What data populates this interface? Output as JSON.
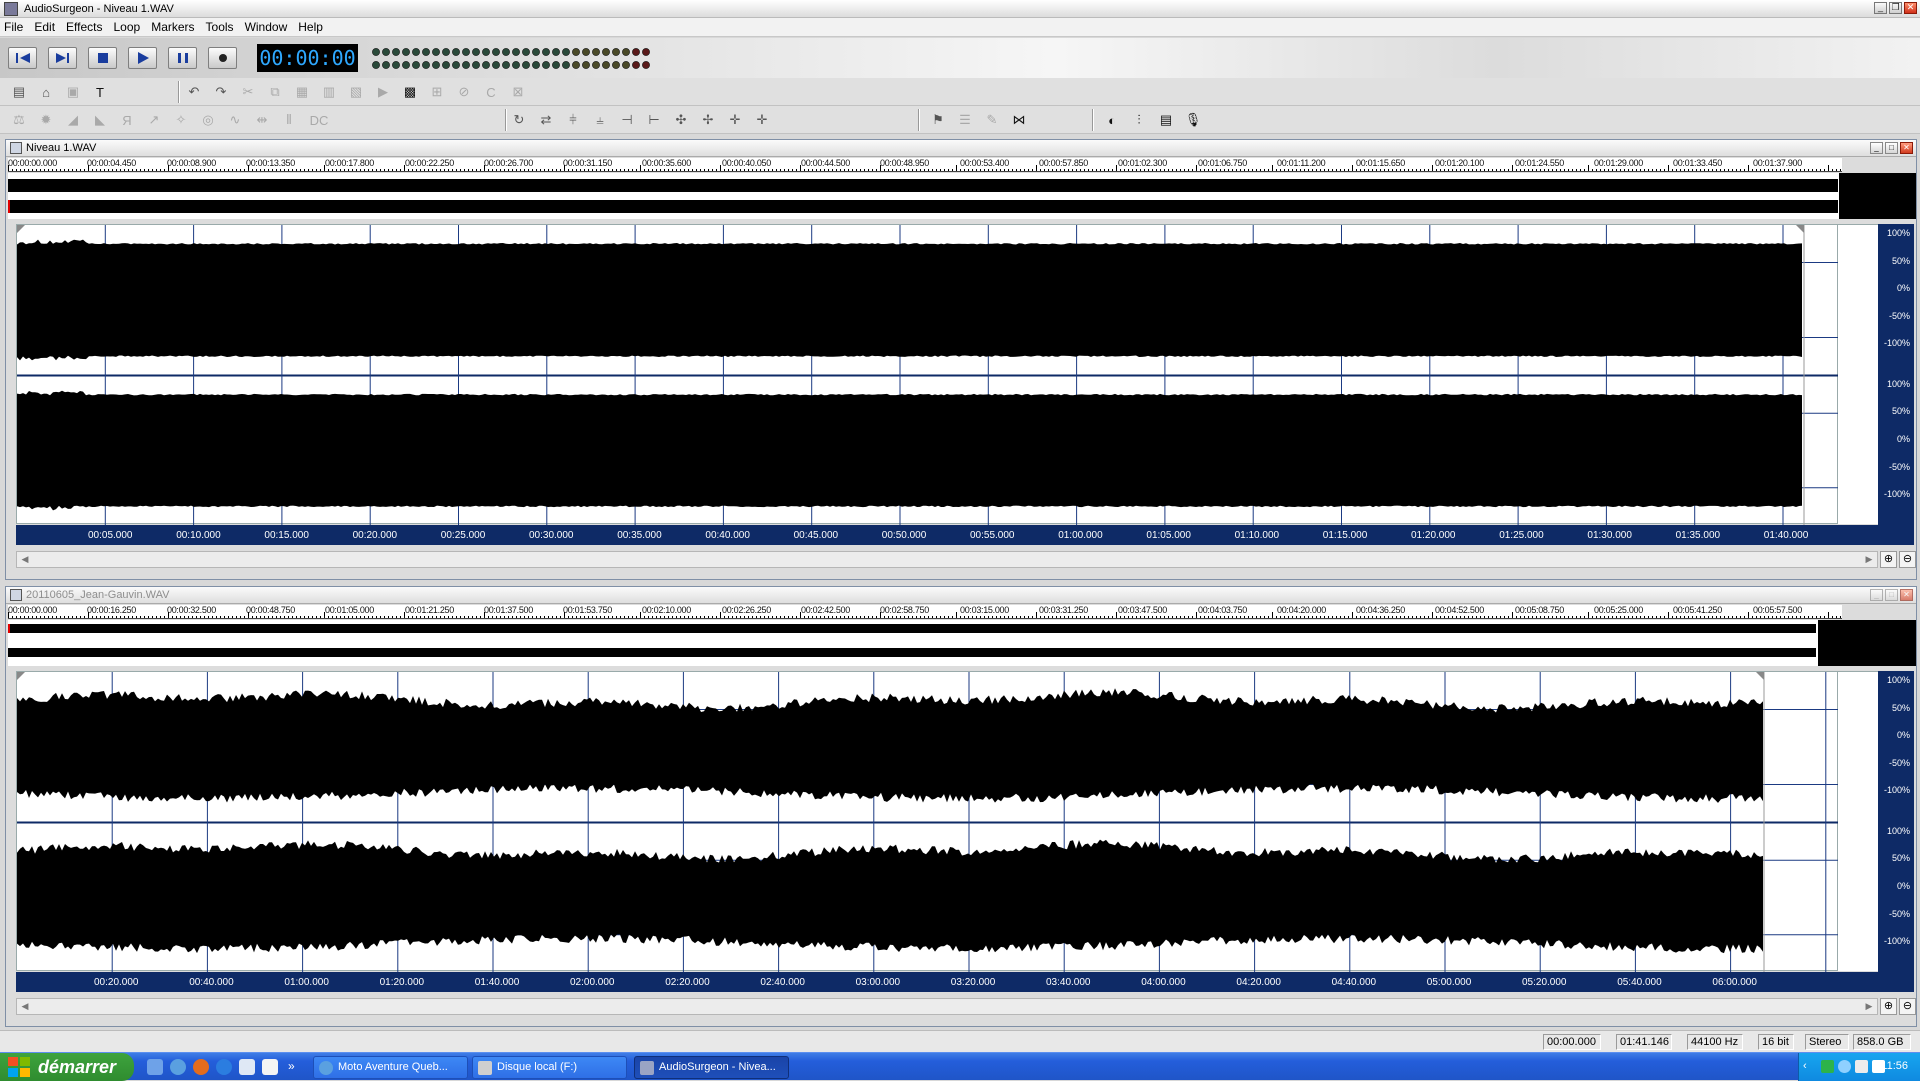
{
  "window": {
    "title": "AudioSurgeon - Niveau 1.WAV"
  },
  "menu": [
    "File",
    "Edit",
    "Effects",
    "Loop",
    "Markers",
    "Tools",
    "Window",
    "Help"
  ],
  "transport": {
    "time": "00:00:00"
  },
  "doc1": {
    "title": "Niveau 1.WAV",
    "ruler": [
      "00:00:00.000",
      "00:00:04.450",
      "00:00:08.900",
      "00:00:13.350",
      "00:00:17.800",
      "00:00:22.250",
      "00:00:26.700",
      "00:00:31.150",
      "00:00:35.600",
      "00:00:40.050",
      "00:00:44.500",
      "00:00:48.950",
      "00:00:53.400",
      "00:00:57.850",
      "00:01:02.300",
      "00:01:06.750",
      "00:01:11.200",
      "00:01:15.650",
      "00:01:20.100",
      "00:01:24.550",
      "00:01:29.000",
      "00:01:33.450",
      "00:01:37.900"
    ],
    "timeaxis": [
      "00:05.000",
      "00:10.000",
      "00:15.000",
      "00:20.000",
      "00:25.000",
      "00:30.000",
      "00:35.000",
      "00:40.000",
      "00:45.000",
      "00:50.000",
      "00:55.000",
      "01:00.000",
      "01:05.000",
      "01:10.000",
      "01:15.000",
      "01:20.000",
      "01:25.000",
      "01:30.000",
      "01:35.000",
      "01:40.000"
    ]
  },
  "doc2": {
    "title": "20110605_Jean-Gauvin.WAV",
    "ruler": [
      "00:00:00.000",
      "00:00:16.250",
      "00:00:32.500",
      "00:00:48.750",
      "00:01:05.000",
      "00:01:21.250",
      "00:01:37.500",
      "00:01:53.750",
      "00:02:10.000",
      "00:02:26.250",
      "00:02:42.500",
      "00:02:58.750",
      "00:03:15.000",
      "00:03:31.250",
      "00:03:47.500",
      "00:04:03.750",
      "00:04:20.000",
      "00:04:36.250",
      "00:04:52.500",
      "00:05:08.750",
      "00:05:25.000",
      "00:05:41.250",
      "00:05:57.500"
    ],
    "timeaxis": [
      "00:20.000",
      "00:40.000",
      "01:00.000",
      "01:20.000",
      "01:40.000",
      "02:00.000",
      "02:20.000",
      "02:40.000",
      "03:00.000",
      "03:20.000",
      "03:40.000",
      "04:00.000",
      "04:20.000",
      "04:40.000",
      "05:00.000",
      "05:20.000",
      "05:40.000",
      "06:00.000"
    ]
  },
  "percent_labels": [
    "100%",
    "50%",
    "0%",
    "-50%",
    "-100%"
  ],
  "status": {
    "pos": "00:00.000",
    "length": "01:41.146",
    "rate": "44100 Hz",
    "bits": "16 bit",
    "channels": "Stereo",
    "disk": "858.0 GB"
  },
  "taskbar": {
    "start": "démarrer",
    "tasks": [
      "Moto Aventure Queb...",
      "Disque local (F:)",
      "AudioSurgeon - Nivea..."
    ],
    "clock": "11:56"
  },
  "colors": {
    "axis": "#0e2a66",
    "time": "#2ea8ff",
    "wave": "#000000"
  }
}
